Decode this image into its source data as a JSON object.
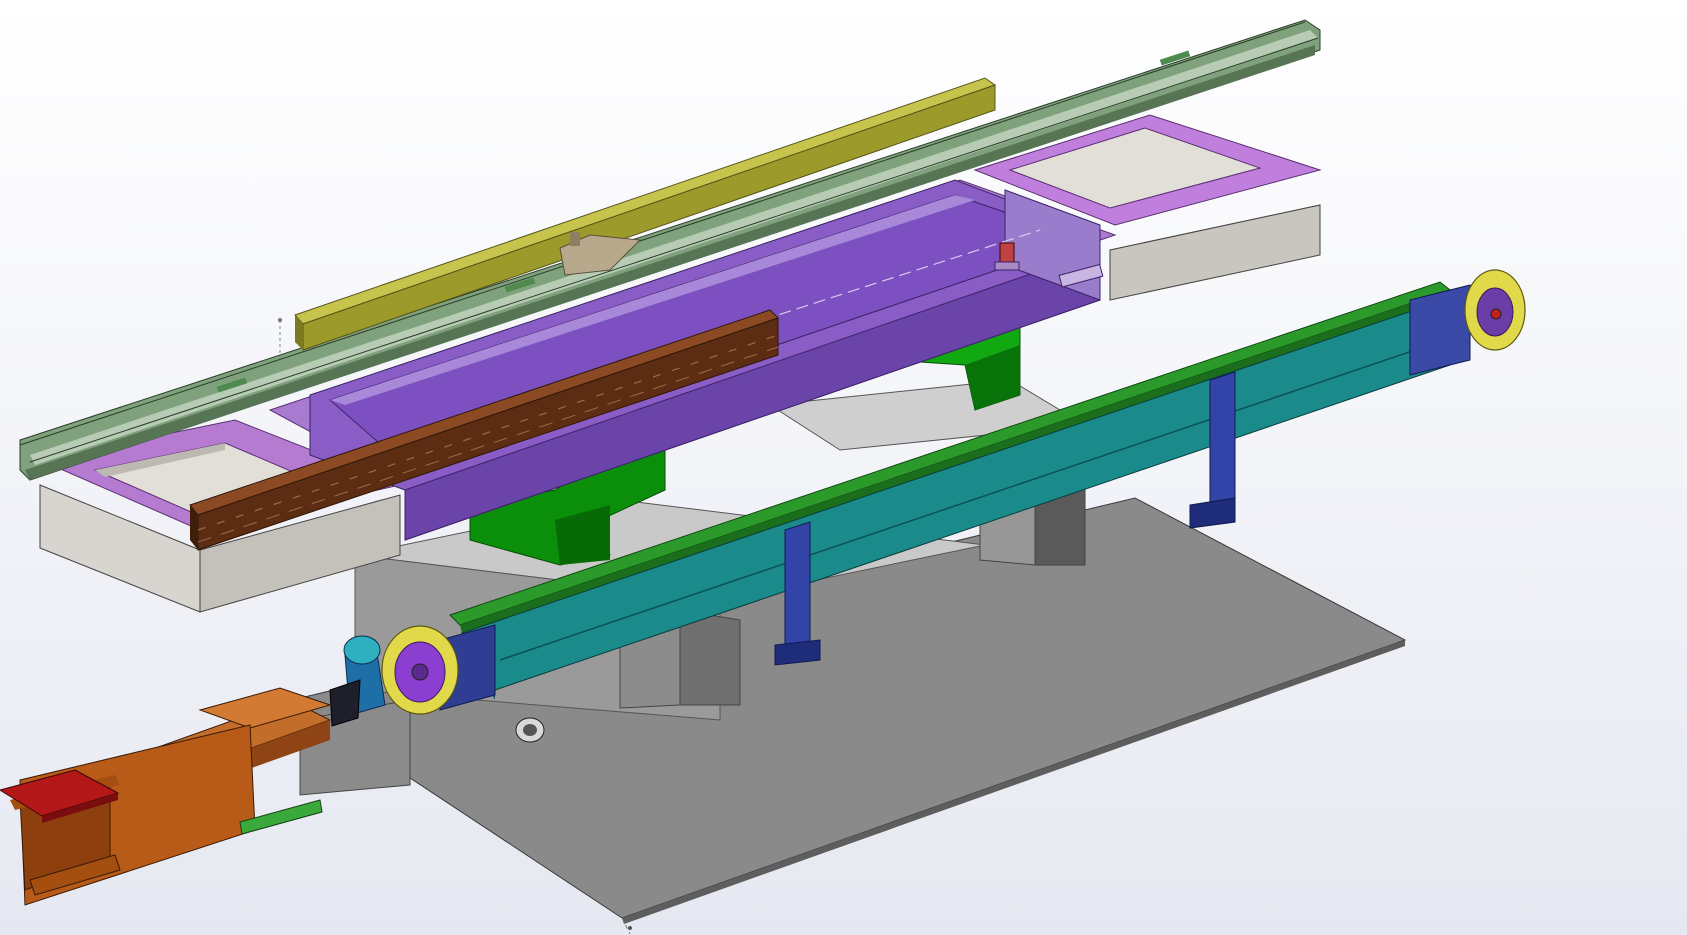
{
  "viewport": {
    "background_top": "#ffffff",
    "background_bottom": "#e3e6f0"
  },
  "model": {
    "components": [
      {
        "name": "base-plate",
        "color": "#8a8a8a"
      },
      {
        "name": "support-blocks",
        "color": "#9c9c9c"
      },
      {
        "name": "green-brackets",
        "color": "#1fae1f"
      },
      {
        "name": "purple-frame",
        "color": "#b26dd2"
      },
      {
        "name": "violet-beam",
        "color": "#8f62c9"
      },
      {
        "name": "linear-rails",
        "color": "#6b8f68"
      },
      {
        "name": "yellow-bar",
        "color": "#b3b22c"
      },
      {
        "name": "brown-rack",
        "color": "#6e3a1f"
      },
      {
        "name": "teal-conveyor",
        "color": "#1e8c8c"
      },
      {
        "name": "navy-legs",
        "color": "#2e3a8f"
      },
      {
        "name": "conveyor-pulleys",
        "color": "#d8cf4a"
      },
      {
        "name": "orange-beam",
        "color": "#b65a18"
      },
      {
        "name": "red-plate",
        "color": "#b01818"
      },
      {
        "name": "motor",
        "color": "#2fa3b0"
      }
    ]
  }
}
